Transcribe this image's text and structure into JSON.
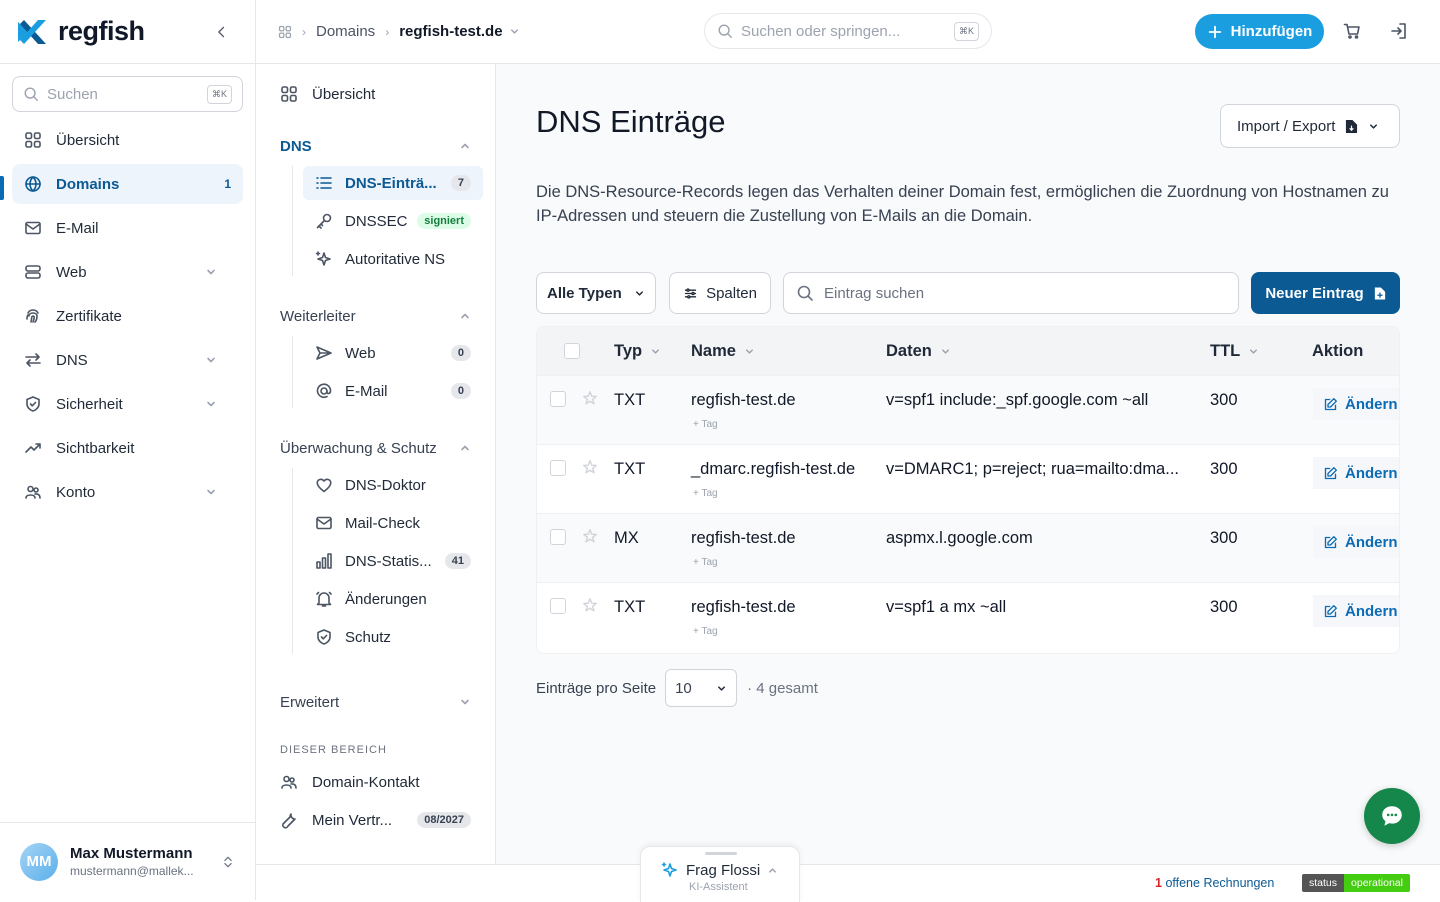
{
  "brand": {
    "name": "regfish",
    "accent": "#0b5a94",
    "cta": "#1a9ee0"
  },
  "sidebar": {
    "search_placeholder": "Suchen",
    "search_kbd": "⌘K",
    "items": [
      {
        "label": "Übersicht",
        "icon": "grid-icon"
      },
      {
        "label": "Domains",
        "icon": "globe-icon",
        "count": "1"
      },
      {
        "label": "E-Mail",
        "icon": "mail-icon"
      },
      {
        "label": "Web",
        "icon": "server-icon"
      },
      {
        "label": "Zertifikate",
        "icon": "fingerprint-icon"
      },
      {
        "label": "DNS",
        "icon": "arrows-icon"
      },
      {
        "label": "Sicherheit",
        "icon": "shield-icon"
      },
      {
        "label": "Sichtbarkeit",
        "icon": "trend-icon"
      },
      {
        "label": "Konto",
        "icon": "users-icon"
      }
    ],
    "user": {
      "initials": "MM",
      "name": "Max Mustermann",
      "email": "mustermann@mallek..."
    }
  },
  "topbar": {
    "crumbs": [
      "Domains",
      "regfish-test.de"
    ],
    "search_placeholder": "Suchen oder springen...",
    "search_kbd": "⌘K",
    "add_label": "Hinzufügen"
  },
  "subnav": {
    "overview": "Übersicht",
    "dns_group": "DNS",
    "dns_items": [
      {
        "label": "DNS-Einträ...",
        "badge": "7"
      },
      {
        "label": "DNSSEC",
        "badge": "signiert"
      },
      {
        "label": "Autoritative NS"
      }
    ],
    "fwd_group": "Weiterleiter",
    "fwd_items": [
      {
        "label": "Web",
        "badge": "0"
      },
      {
        "label": "E-Mail",
        "badge": "0"
      }
    ],
    "mon_group": "Überwachung & Schutz",
    "mon_items": [
      {
        "label": "DNS-Doktor"
      },
      {
        "label": "Mail-Check"
      },
      {
        "label": "DNS-Statis...",
        "badge": "41"
      },
      {
        "label": "Änderungen"
      },
      {
        "label": "Schutz"
      }
    ],
    "adv_group": "Erweitert",
    "section_label": "DIESER BEREICH",
    "area_items": [
      {
        "label": "Domain-Kontakt"
      },
      {
        "label": "Mein Vertr...",
        "badge": "08/2027"
      }
    ]
  },
  "main": {
    "title": "DNS Einträge",
    "import_label": "Import / Export",
    "description": "Die DNS-Resource-Records legen das Verhalten deiner Domain fest, ermöglichen die Zuordnung von Hostnamen zu IP-Adressen und steuern die Zustellung von E-Mails an die Domain.",
    "type_filter": "Alle Typen",
    "columns_label": "Spalten",
    "search_placeholder": "Eintrag suchen",
    "new_entry_label": "Neuer Eintrag",
    "columns": {
      "type": "Typ",
      "name": "Name",
      "data": "Daten",
      "ttl": "TTL",
      "action": "Aktion"
    },
    "rows": [
      {
        "type": "TXT",
        "name": "regfish-test.de",
        "data": "v=spf1 include:_spf.google.com ~all",
        "ttl": "300",
        "tag": "+ Tag",
        "action": "Ändern"
      },
      {
        "type": "TXT",
        "name": "_dmarc.regfish-test.de",
        "data": "v=DMARC1; p=reject; rua=mailto:dma...",
        "ttl": "300",
        "tag": "+ Tag",
        "action": "Ändern"
      },
      {
        "type": "MX",
        "name": "regfish-test.de",
        "data": "aspmx.l.google.com",
        "ttl": "300",
        "tag": "+ Tag",
        "action": "Ändern"
      },
      {
        "type": "TXT",
        "name": "regfish-test.de",
        "data": "v=spf1 a mx ~all",
        "ttl": "300",
        "tag": "+ Tag",
        "action": "Ändern"
      }
    ],
    "pager_label": "Einträge pro Seite",
    "per_page": "10",
    "total": "· 4 gesamt"
  },
  "bottom": {
    "invoices_count": "1",
    "invoices_label": "offene Rechnungen",
    "status_left": "status",
    "status_right": "operational",
    "assistant_title": "Frag Flossi",
    "assistant_sub": "KI-Assistent"
  }
}
